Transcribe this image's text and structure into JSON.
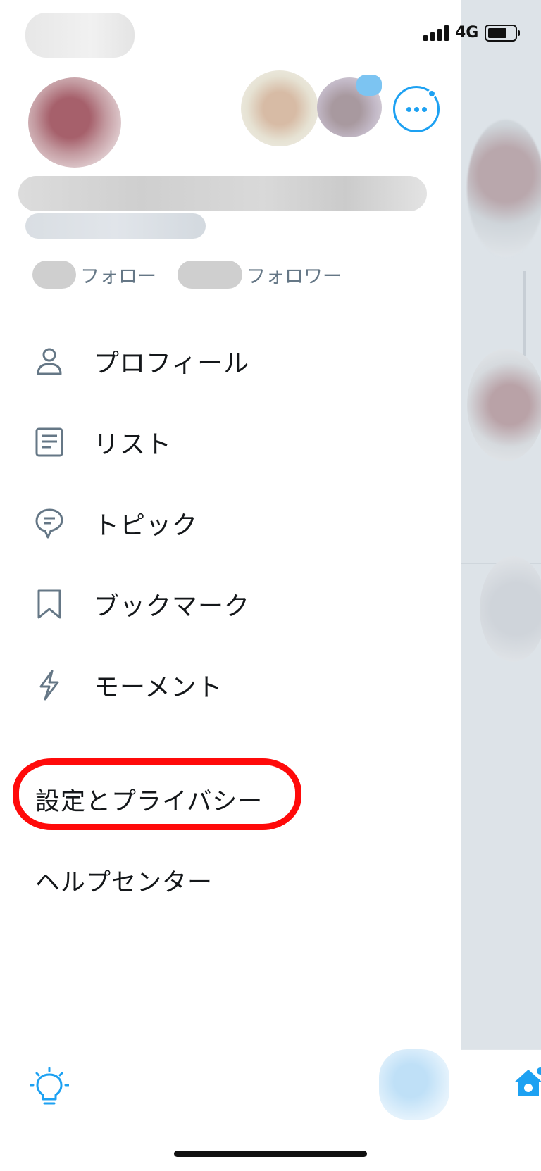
{
  "status_bar": {
    "network": "4G",
    "icons": [
      "signal-bars-icon",
      "battery-icon"
    ]
  },
  "profile": {
    "following_label": "フォロー",
    "followers_label": "フォロワー"
  },
  "menu": {
    "items": [
      {
        "label": "プロフィール",
        "icon": "person-icon"
      },
      {
        "label": "リスト",
        "icon": "list-icon"
      },
      {
        "label": "トピック",
        "icon": "topic-icon"
      },
      {
        "label": "ブックマーク",
        "icon": "bookmark-icon"
      },
      {
        "label": "モーメント",
        "icon": "lightning-icon"
      }
    ]
  },
  "secondary": {
    "settings_label": "設定とプライバシー",
    "help_label": "ヘルプセンター"
  },
  "colors": {
    "accent": "#1da1f2",
    "text": "#14171a",
    "secondary_text": "#657786",
    "annotation": "#ff0a0a"
  }
}
